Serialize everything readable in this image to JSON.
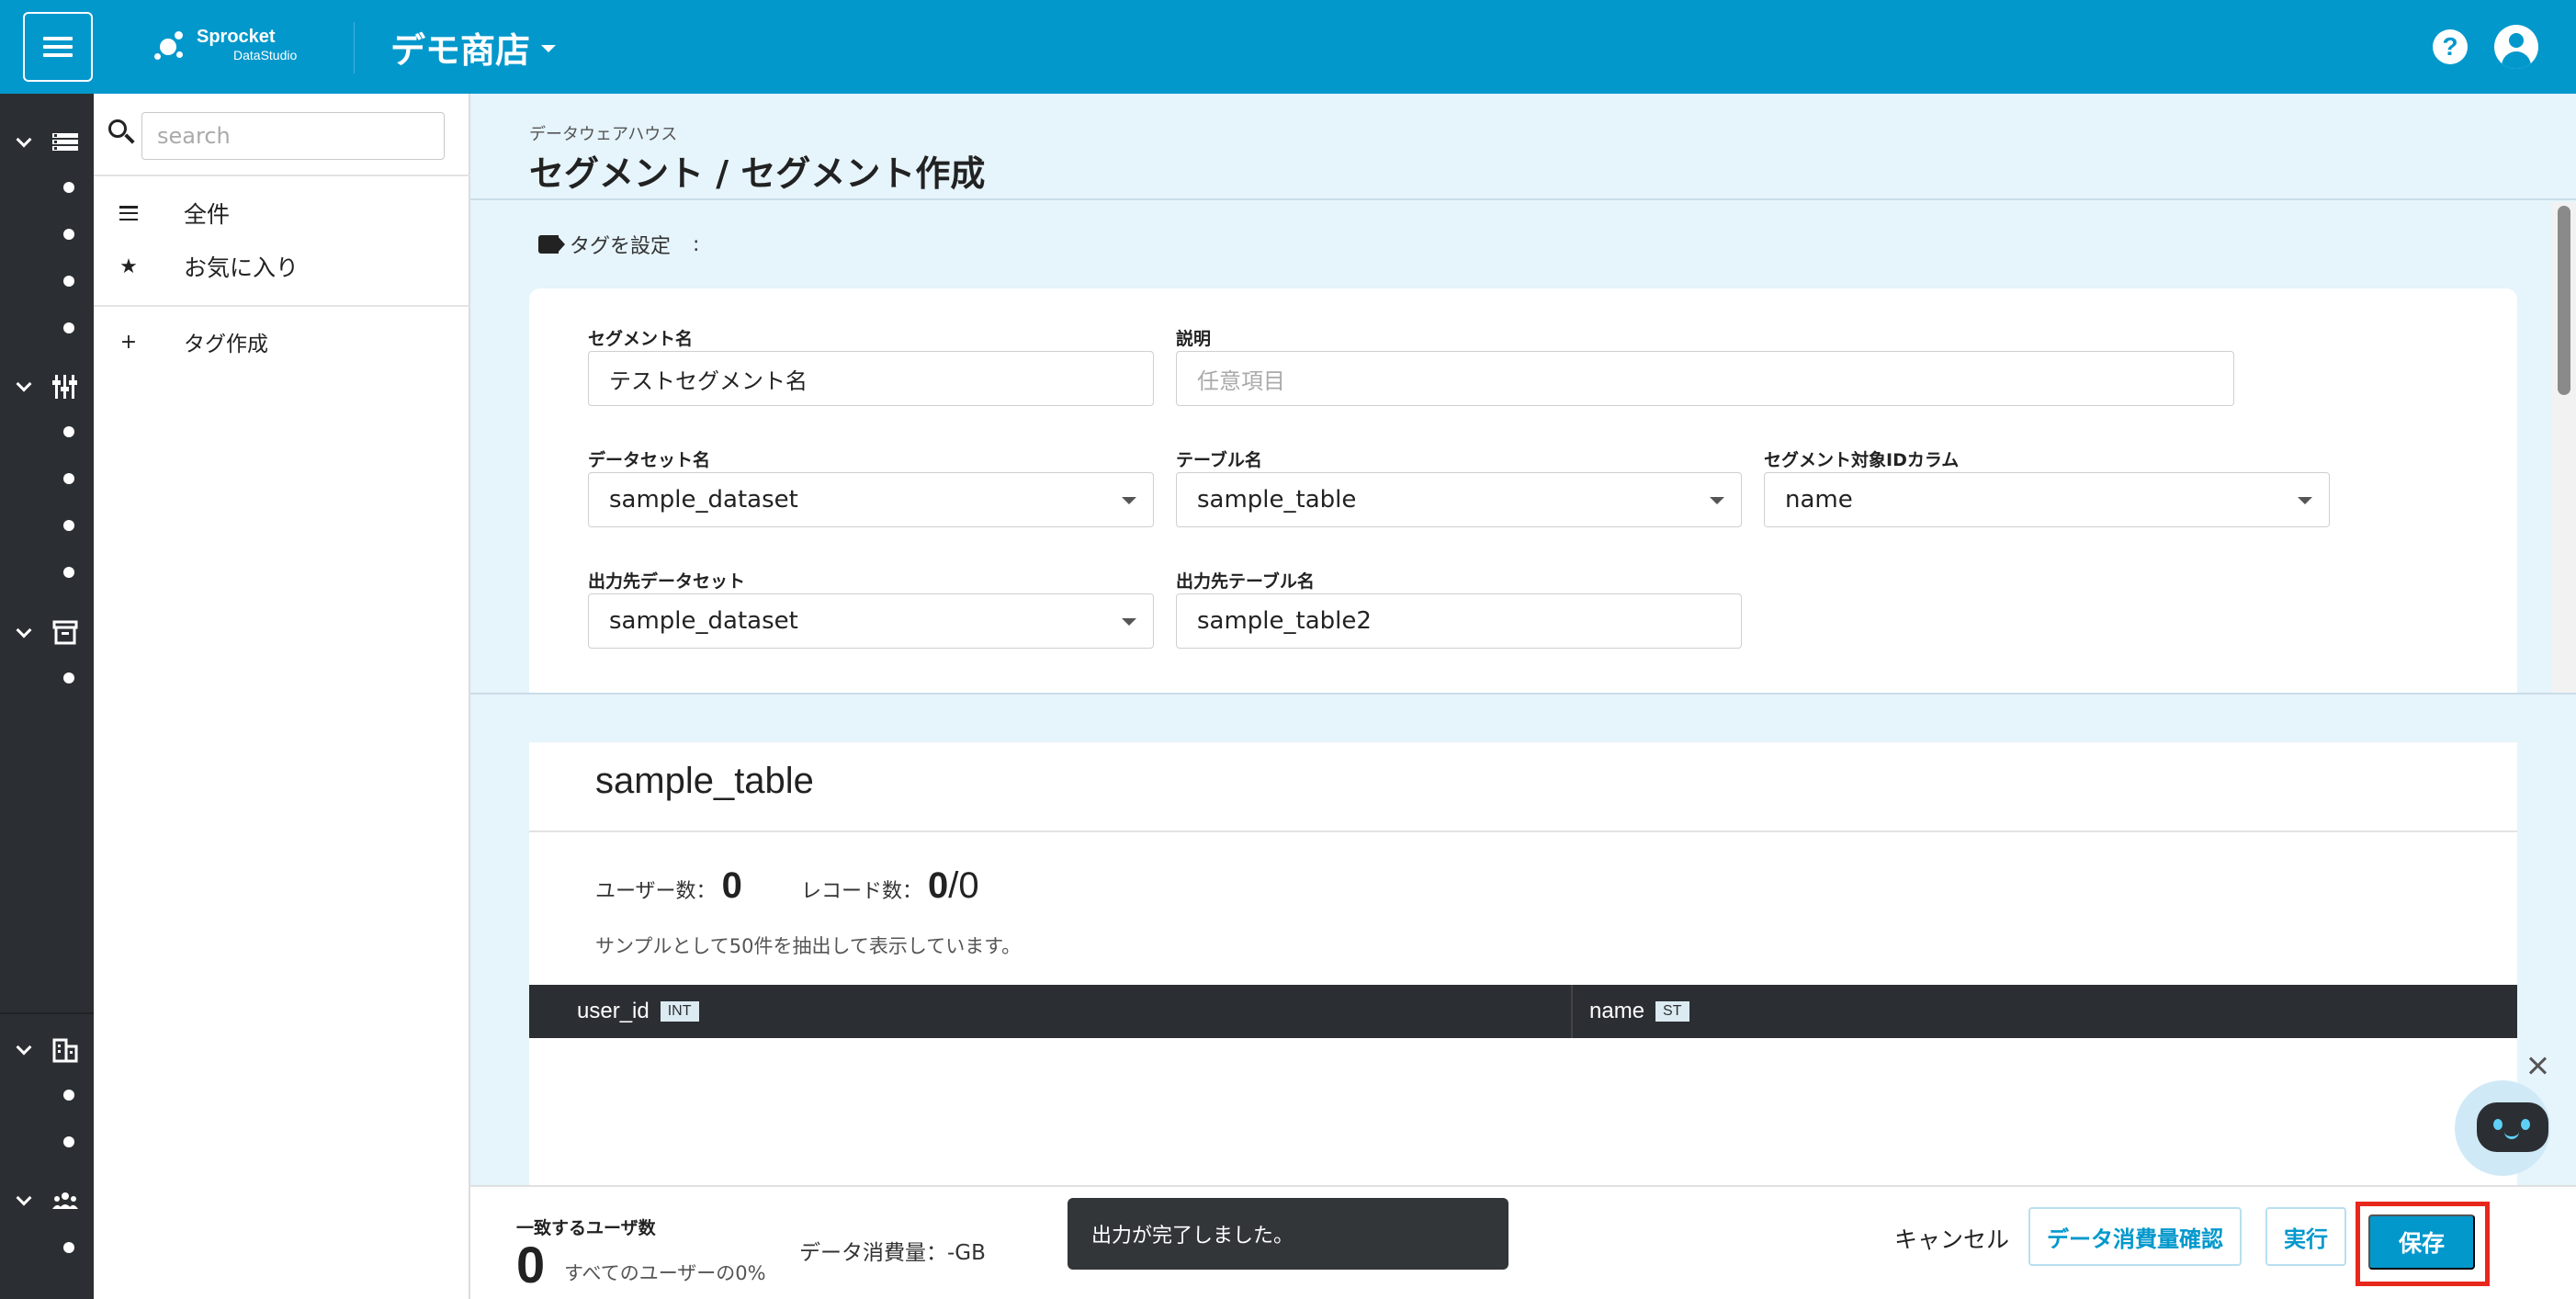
{
  "header": {
    "logo_name": "Sprocket",
    "logo_sub": "DataStudio",
    "shop_name": "デモ商店"
  },
  "side": {
    "search_placeholder": "search",
    "items": [
      {
        "label": "全件",
        "icon": "list-icon"
      },
      {
        "label": "お気に入り",
        "icon": "star-icon"
      },
      {
        "label": "タグ作成",
        "icon": "plus-icon"
      }
    ]
  },
  "main": {
    "breadcrumb": "データウェアハウス",
    "title": "セグメント / セグメント作成",
    "tag_label": "タグを設定",
    "tag_colon": ":"
  },
  "form": {
    "segment_name_label": "セグメント名",
    "segment_name_value": "テストセグメント名",
    "description_label": "説明",
    "description_placeholder": "任意項目",
    "dataset_label": "データセット名",
    "dataset_value": "sample_dataset",
    "table_label": "テーブル名",
    "table_value": "sample_table",
    "id_column_label": "セグメント対象IDカラム",
    "id_column_value": "name",
    "out_dataset_label": "出力先データセット",
    "out_dataset_value": "sample_dataset",
    "out_table_label": "出力先テーブル名",
    "out_table_value": "sample_table2"
  },
  "table": {
    "title": "sample_table",
    "users_label": "ユーザー数：",
    "users_value": "0",
    "records_label": "レコード数：",
    "records_value": "0",
    "records_total": "/0",
    "note": "サンプルとして50件を抽出して表示しています。",
    "columns": [
      {
        "name": "user_id",
        "type": "INT"
      },
      {
        "name": "name",
        "type": "ST"
      }
    ]
  },
  "footer": {
    "match_label": "一致するユーザ数",
    "match_value": "0",
    "match_pct": "すべてのユーザーの0%",
    "usage": "データ消費量：-GB",
    "toast": "出力が完了しました。",
    "cancel": "キャンセル",
    "check_usage": "データ消費量確認",
    "run": "実行",
    "save": "保存"
  },
  "colors": {
    "primary": "#0398cc",
    "rail": "#2b2f33",
    "highlight": "#e8271c"
  }
}
